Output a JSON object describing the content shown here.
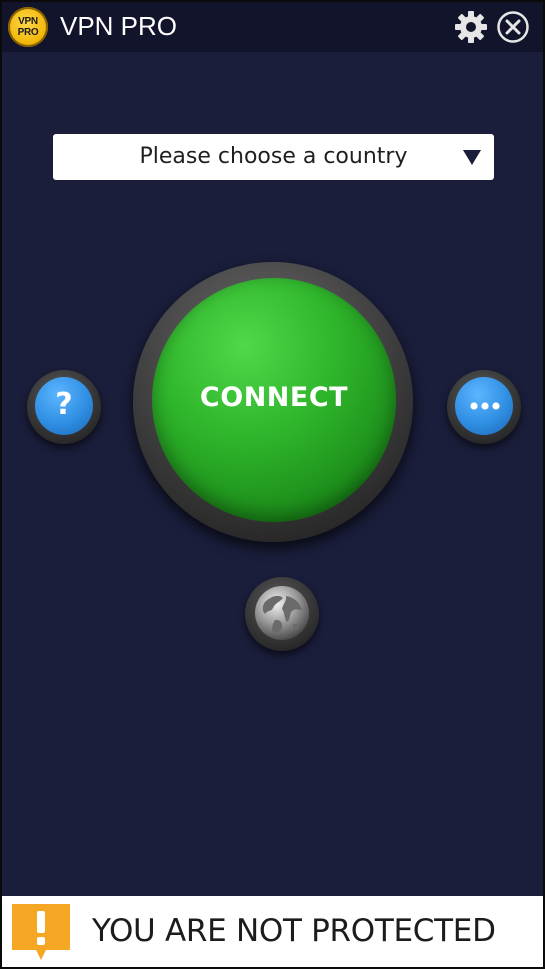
{
  "app": {
    "title": "VPN PRO",
    "logo_text": "VPN\nPRO"
  },
  "header": {
    "settings_icon": "gear-icon",
    "close_icon": "close-icon"
  },
  "country_select": {
    "placeholder": "Please choose a country"
  },
  "main": {
    "connect_label": "CONNECT",
    "help_glyph": "?",
    "more_icon": "more-dots-icon",
    "globe_icon": "globe-icon"
  },
  "status": {
    "text": "YOU ARE NOT PROTECTED",
    "icon": "warning-icon"
  },
  "colors": {
    "background": "#1a1e3b",
    "titlebar": "#11142a",
    "connect_green": "#2fb52b",
    "accent_blue": "#2f8fe3",
    "warning_orange": "#f5a623",
    "logo_gold": "#f2b90d"
  }
}
